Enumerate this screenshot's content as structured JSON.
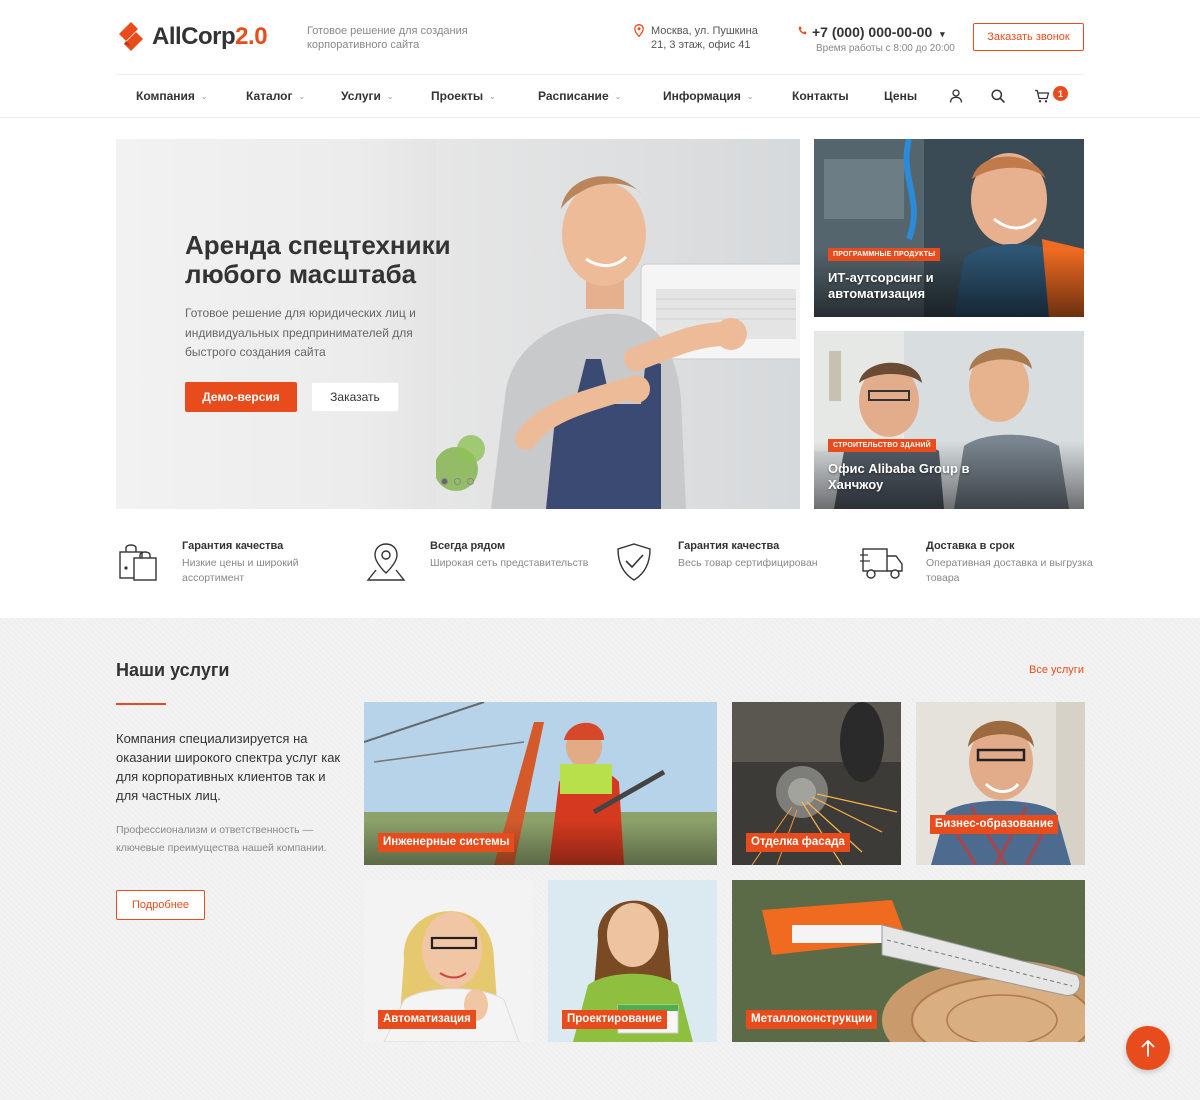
{
  "brand": {
    "name": "AllCorp",
    "version": "2.0",
    "slogan": "Готовое решение для создания корпоративного сайта",
    "accent": "#e84c1c"
  },
  "header": {
    "address": "Москва, ул. Пушкина 21, 3 этаж, офис 41",
    "phone": "+7 (000) 000-00-00",
    "hours": "Время работы с 8:00 до 20:00",
    "callback_label": "Заказать звонок"
  },
  "nav": {
    "items": [
      {
        "label": "Компания",
        "dropdown": true
      },
      {
        "label": "Каталог",
        "dropdown": true
      },
      {
        "label": "Услуги",
        "dropdown": true
      },
      {
        "label": "Проекты",
        "dropdown": true
      },
      {
        "label": "Расписание",
        "dropdown": true
      },
      {
        "label": "Информация",
        "dropdown": true
      },
      {
        "label": "Контакты",
        "dropdown": false
      },
      {
        "label": "Цены",
        "dropdown": false
      }
    ],
    "icons": [
      "user-icon",
      "search-icon",
      "cart-icon"
    ],
    "cart_count": "1"
  },
  "hero": {
    "title": "Аренда спецтехники любого масштаба",
    "text": "Готовое решение для юридических лиц и индивидуальных предпринимателей для быстрого создания сайта",
    "demo_label": "Демо-версия",
    "order_label": "Заказать",
    "slides": 3,
    "active_slide": 1
  },
  "side_cards": [
    {
      "tag": "Программные продукты",
      "title": "ИТ-аутсорсинг и автоматизация"
    },
    {
      "tag": "Строительство зданий",
      "title": "Офис Alibaba Group в Ханчжоу"
    }
  ],
  "features": [
    {
      "icon": "shopping-bags-icon",
      "title": "Гарантия качества",
      "desc": "Низкие цены и широкий ассортимент"
    },
    {
      "icon": "map-pin-icon",
      "title": "Всегда рядом",
      "desc": "Широкая сеть представительств"
    },
    {
      "icon": "shield-check-icon",
      "title": "Гарантия качества",
      "desc": "Весь товар сертифицирован"
    },
    {
      "icon": "delivery-truck-icon",
      "title": "Доставка в срок",
      "desc": "Оперативная доставка и выгрузка товара"
    }
  ],
  "services": {
    "title": "Наши услуги",
    "all_label": "Все услуги",
    "lead": "Компания специализируется на оказании широкого спектра услуг как для корпоративных клиентов так и для частных лиц.",
    "sub": "Профессионализм и ответственность — ключевые преимущества нашей компании.",
    "more_label": "Подробнее",
    "tiles": [
      {
        "label": "Инженерные системы"
      },
      {
        "label": "Отделка фасада"
      },
      {
        "label": "Бизнес-образование"
      },
      {
        "label": "Автоматизация"
      },
      {
        "label": "Проектирование"
      },
      {
        "label": "Металлоконструкции"
      }
    ]
  }
}
